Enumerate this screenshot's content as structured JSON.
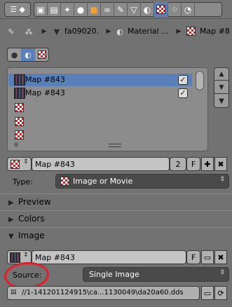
{
  "breadcrumb": {
    "item1": "fa09020.",
    "item2": "Material ...",
    "item3": "Map #8"
  },
  "texture_slots": [
    {
      "label": "Map #843",
      "checked": true,
      "selected": true
    },
    {
      "label": "Map #843",
      "checked": true,
      "selected": false
    },
    {
      "label": "",
      "checked": false,
      "selected": false
    },
    {
      "label": "",
      "checked": false,
      "selected": false
    },
    {
      "label": "",
      "checked": false,
      "selected": false
    }
  ],
  "texture_datablock": {
    "name": "Map #843",
    "users": "2",
    "fake_user": "F"
  },
  "type": {
    "label": "Type:",
    "value": "Image or Movie"
  },
  "sections": {
    "preview": "Preview",
    "colors": "Colors",
    "image": "Image"
  },
  "image_datablock": {
    "name": "Map #843",
    "fake_user": "F"
  },
  "source": {
    "label": "Source:",
    "value": "Single Image"
  },
  "filepath": "//1-141201124915\\ca...1130049\\da20a60.dds",
  "annotation_color": "#e0202a",
  "accent_color": "#5980b8"
}
